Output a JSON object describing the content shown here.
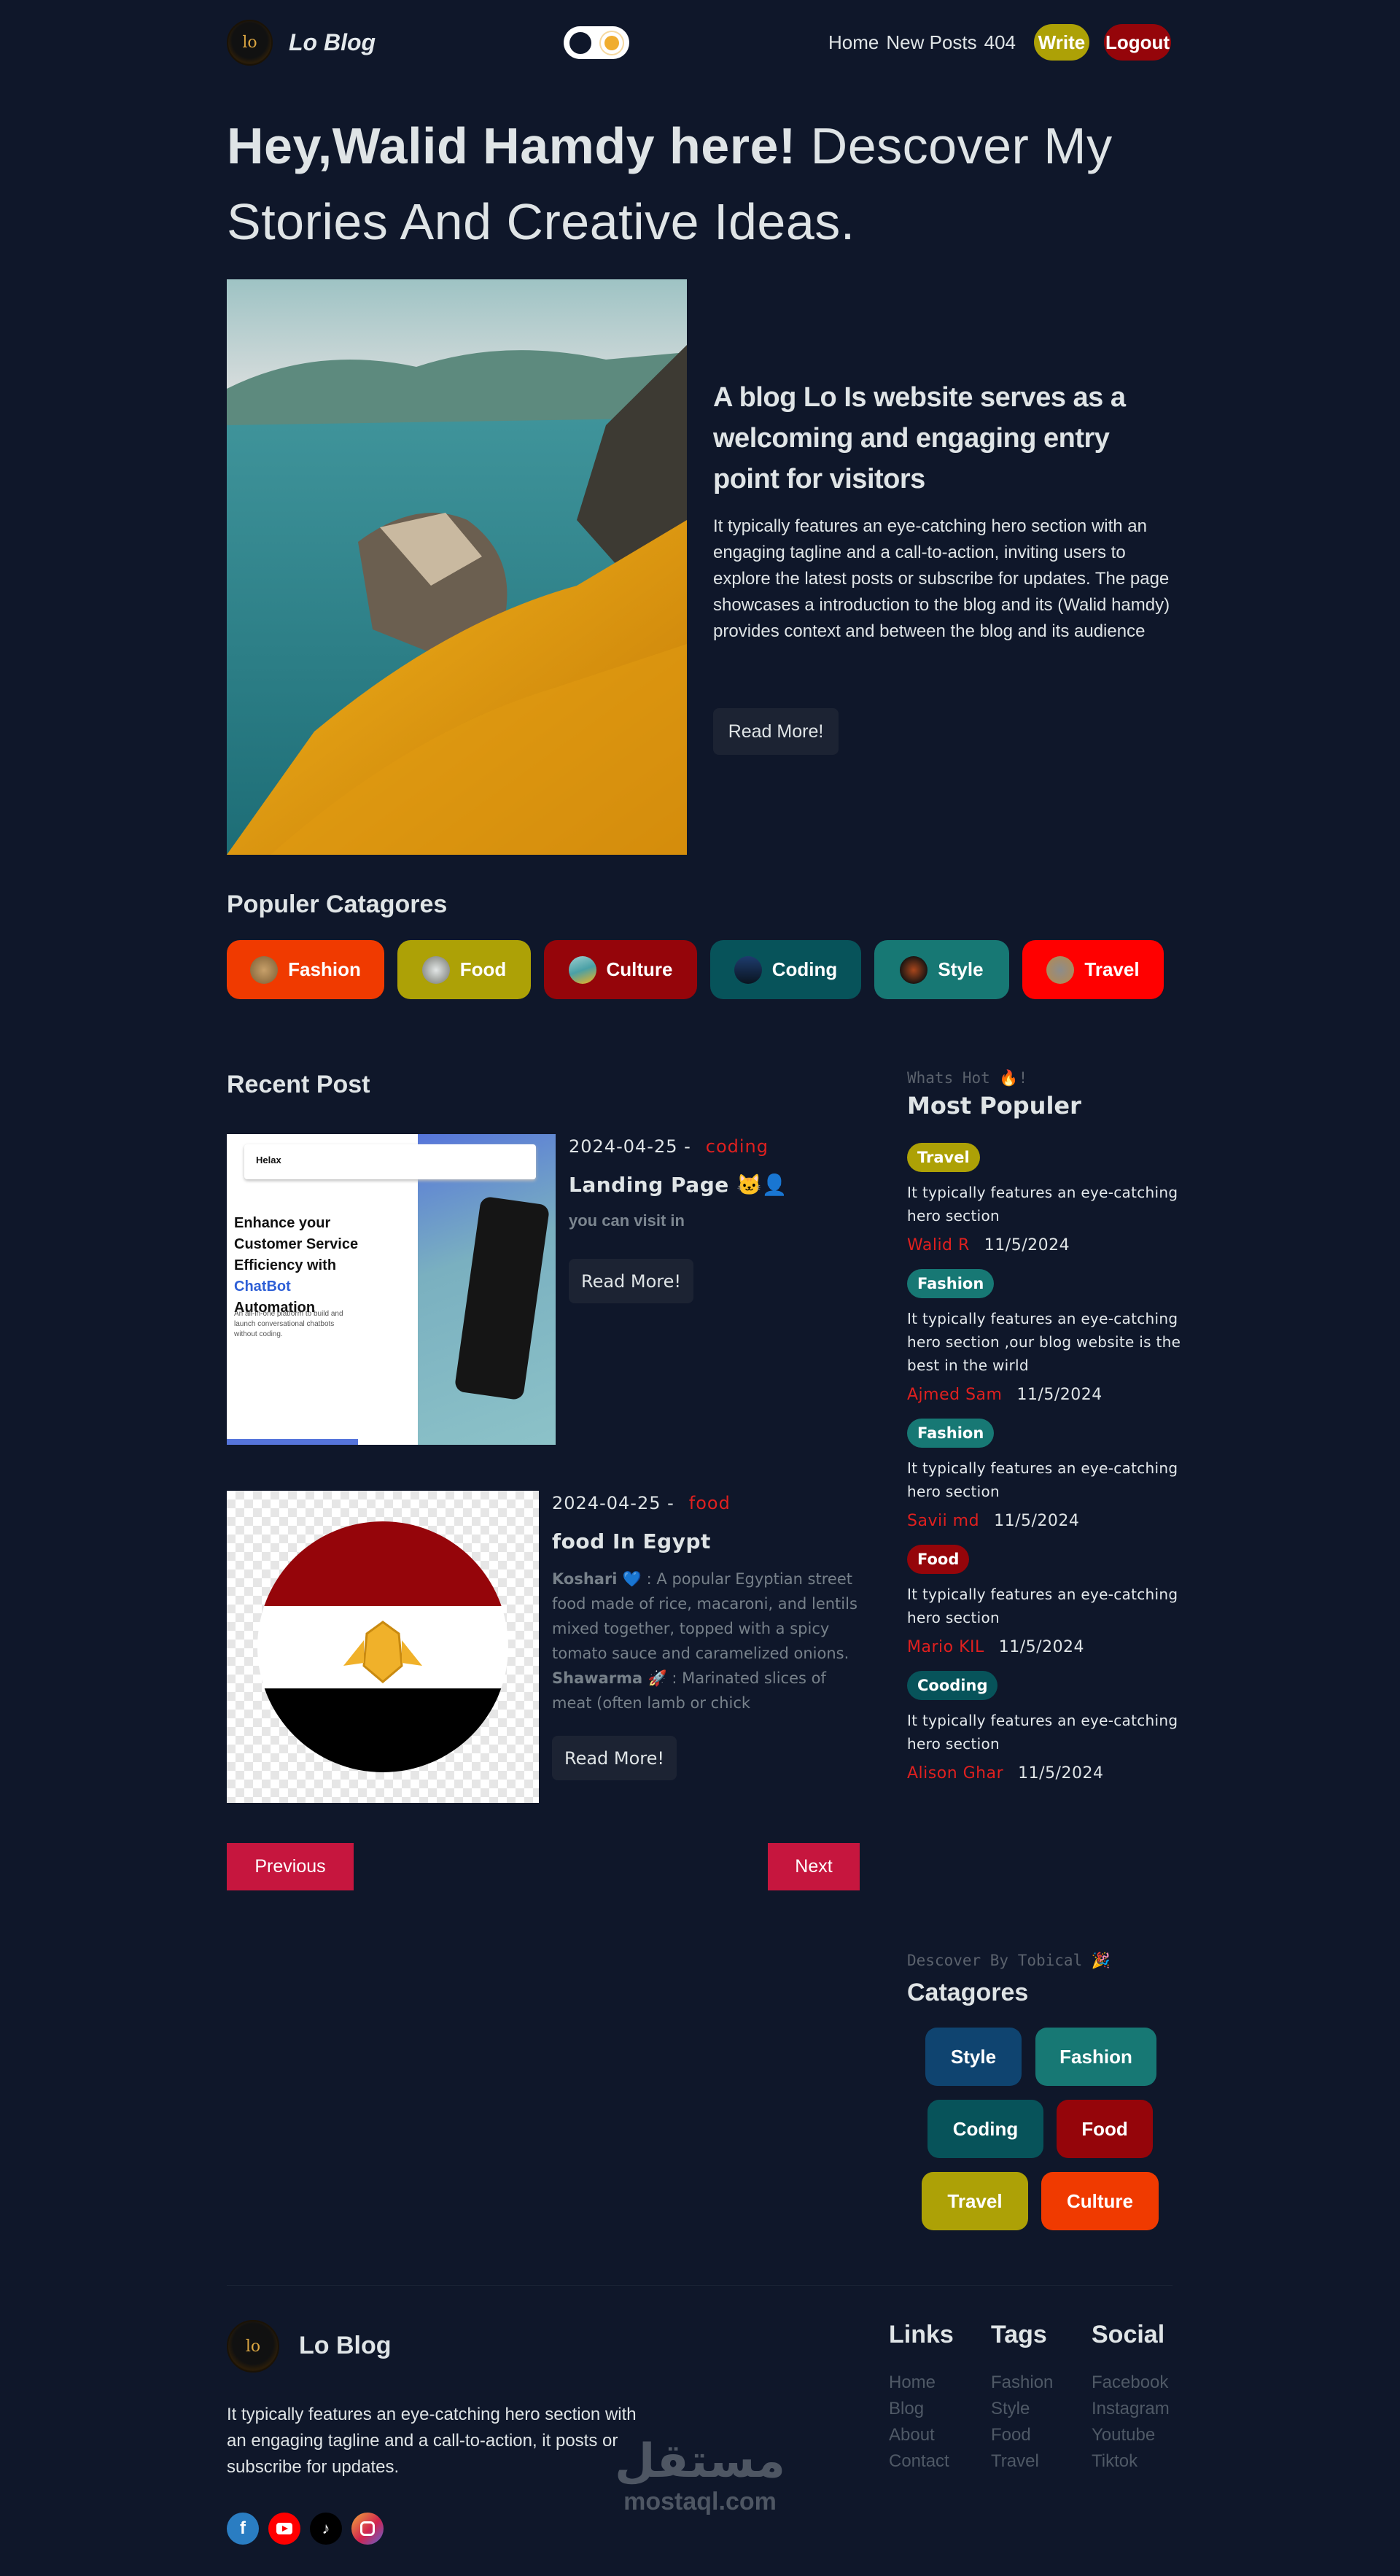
{
  "nav": {
    "brand": "Lo Blog",
    "logo_text": "lo",
    "theme_toggle": "dark",
    "links": [
      "Home",
      "New Posts",
      "404"
    ],
    "write": "Write",
    "logout": "Logout"
  },
  "hero": {
    "title_bold": "Hey,Walid Hamdy here!",
    "title_rest": " Descover My Stories And Creative Ideas.",
    "subtitle": "A blog Lo Is website serves as a welcoming and engaging entry point for visitors",
    "description": "It typically features an eye-catching hero section with an engaging tagline and a call-to-action, inviting users to explore the latest posts or subscribe for updates. The page showcases a introduction to the blog and its (Walid hamdy) provides context and between the blog and its audience",
    "read_more": "Read More!"
  },
  "popular_categories": {
    "title": "Populer Catagores",
    "items": [
      {
        "label": "Fashion",
        "color": "#f03a00"
      },
      {
        "label": "Food",
        "color": "#ada106"
      },
      {
        "label": "Culture",
        "color": "#95050a"
      },
      {
        "label": "Coding",
        "color": "#07535a"
      },
      {
        "label": "Style",
        "color": "#177874"
      },
      {
        "label": "Travel",
        "color": "#ff0000"
      }
    ]
  },
  "recent": {
    "title": "Recent Post",
    "posts": [
      {
        "date": "2024-04-25 -",
        "tag": "coding",
        "title": "Landing Page 🐱‍👤",
        "excerpt": "you can visit in",
        "read_more": "Read More!",
        "thumb": {
          "brand": "Helax",
          "headline": "Enhance your Customer Service Efficiency with",
          "accent": "ChatBot",
          "headline_end": " Automation",
          "sub": "An all-in-one platform to build and launch conversational chatbots without coding."
        }
      },
      {
        "date": "2024-04-25 -",
        "tag": "food",
        "title": "food In Egypt",
        "koshari": "Koshari 💙",
        "koshari_text": ": A popular Egyptian street food made of rice, macaroni, and lentils mixed together, topped with a spicy tomato sauce and caramelized onions.",
        "shawarma": "Shawarma 🚀",
        "shawarma_text": ": Marinated slices of meat (often lamb or chick",
        "read_more": "Read More!"
      }
    ],
    "prev": "Previous",
    "next": "Next"
  },
  "most_popular": {
    "kicker": "Whats Hot 🔥!",
    "title": "Most Populer",
    "items": [
      {
        "badge": "Travel",
        "color": "#ada106",
        "text": "It typically features an eye-catching hero section",
        "author": "Walid R",
        "date": "11/5/2024"
      },
      {
        "badge": "Fashion",
        "color": "#177874",
        "text": "It typically features an eye-catching hero section ,our blog website is the best in the wirld",
        "author": "Ajmed Sam",
        "date": "11/5/2024"
      },
      {
        "badge": "Fashion",
        "color": "#177874",
        "text": "It typically features an eye-catching hero section",
        "author": "Savii md",
        "date": "11/5/2024"
      },
      {
        "badge": "Food",
        "color": "#95050a",
        "text": "It typically features an eye-catching hero section",
        "author": "Mario KIL",
        "date": "11/5/2024"
      },
      {
        "badge": "Cooding",
        "color": "#07535a",
        "text": "It typically features an eye-catching hero section",
        "author": "Alison Ghar",
        "date": "11/5/2024"
      }
    ]
  },
  "side_categories": {
    "kicker": "Descover By Tobical 🎉",
    "title": "Catagores",
    "items": [
      {
        "label": "Style",
        "color": "#0f4470"
      },
      {
        "label": "Fashion",
        "color": "#177874"
      },
      {
        "label": "Coding",
        "color": "#07535a"
      },
      {
        "label": "Food",
        "color": "#95050a"
      },
      {
        "label": "Travel",
        "color": "#ada106"
      },
      {
        "label": "Culture",
        "color": "#f03a00"
      }
    ]
  },
  "footer": {
    "brand": "Lo Blog",
    "description": "It typically features an eye-catching hero section with an engaging tagline and a call-to-action, it posts or subscribe for updates.",
    "columns": [
      {
        "title": "Links",
        "items": [
          "Home",
          "Blog",
          "About",
          "Contact"
        ]
      },
      {
        "title": "Tags",
        "items": [
          "Fashion",
          "Style",
          "Food",
          "Travel"
        ]
      },
      {
        "title": "Social",
        "items": [
          "Facebook",
          "Instagram",
          "Youtube",
          "Tiktok"
        ]
      }
    ],
    "social_icons": [
      "facebook-icon",
      "youtube-icon",
      "tiktok-icon",
      "instagram-icon"
    ]
  },
  "watermark": {
    "arabic": "مستقل",
    "latin": "mostaql.com"
  }
}
